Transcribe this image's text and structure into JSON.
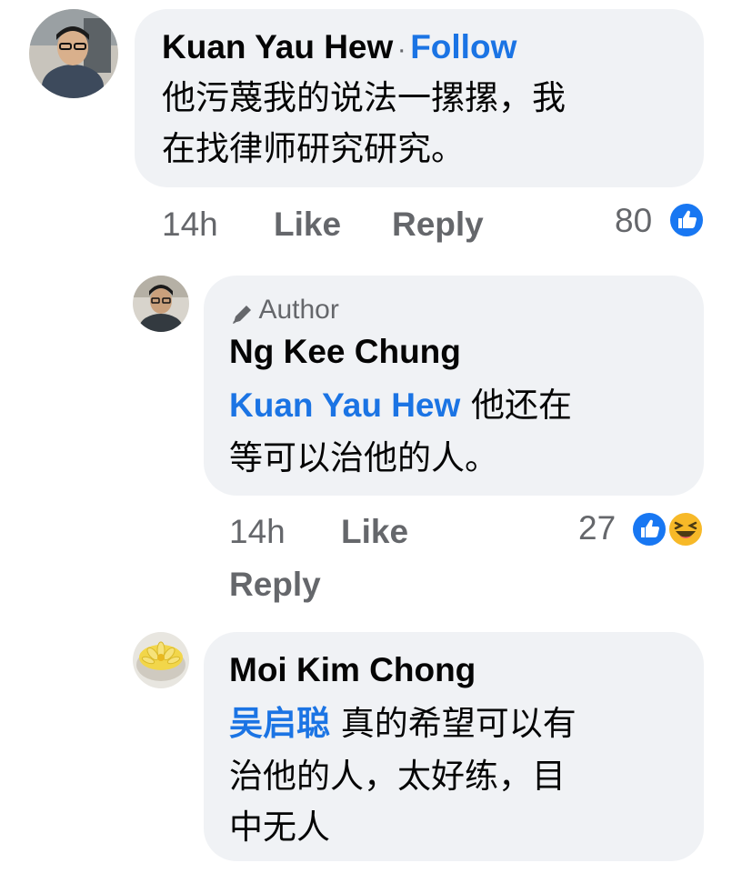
{
  "comments": [
    {
      "name": "Kuan Yau Hew",
      "separator": "·",
      "follow": "Follow",
      "text_line1": "他污蔑我的说法一摞摞，我",
      "text_line2": "在找律师研究研究。",
      "time": "14h",
      "like": "Like",
      "reply": "Reply",
      "reaction_count": "80"
    },
    {
      "author_tag": "Author",
      "name": "Ng Kee Chung",
      "mention": "Kuan Yau Hew",
      "text_line1": " 他还在",
      "text_line2": "等可以治他的人。",
      "time": "14h",
      "like": "Like",
      "reply": "Reply",
      "reaction_count": "27"
    },
    {
      "name": "Moi Kim Chong",
      "mention": "吴启聪",
      "text_line1": " 真的希望可以有",
      "text_line2": "治他的人，太好练，目",
      "text_line3": "中无人"
    }
  ],
  "colors": {
    "link_blue": "#1b74e4",
    "bubble_bg": "#f0f2f5",
    "meta_gray": "#65676b",
    "like_blue": "#1877f2",
    "haha_yellow": "#f7b928"
  },
  "icons": [
    "like-reaction-icon",
    "haha-reaction-icon",
    "pencil-icon"
  ]
}
